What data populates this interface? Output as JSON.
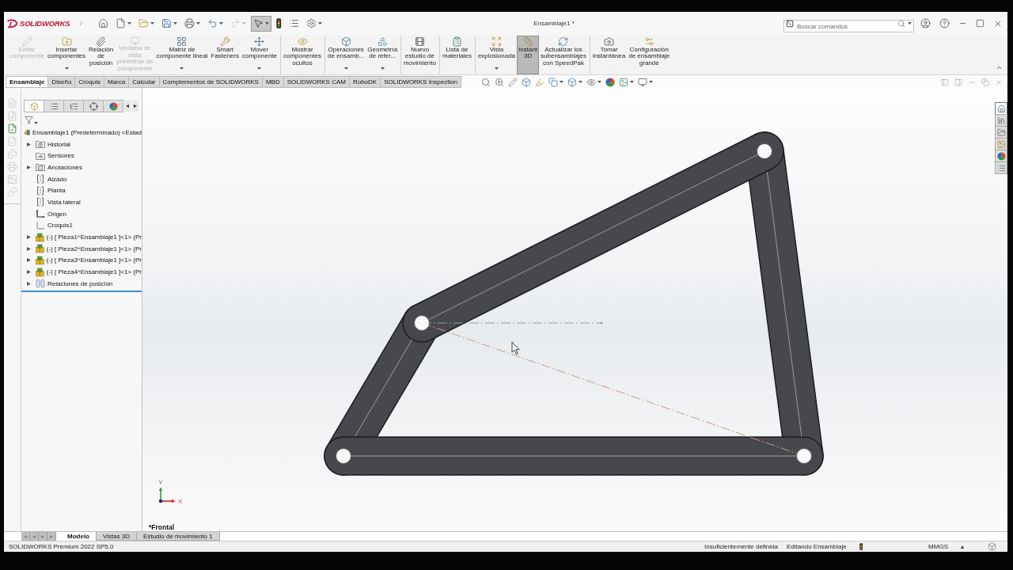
{
  "title_bar": {
    "logo": "SOLIDWORKS",
    "title": "Ensamblaje1 *",
    "search": {
      "placeholder": "Buscar comandos"
    }
  },
  "quick_access": [
    {
      "dropdown": false,
      "disabled": false,
      "selected": false
    },
    {
      "dropdown": true,
      "disabled": false,
      "selected": false
    },
    {
      "dropdown": true,
      "disabled": false,
      "selected": false
    },
    {
      "dropdown": true,
      "disabled": false,
      "selected": false
    },
    {
      "dropdown": true,
      "disabled": false,
      "selected": false
    },
    {
      "dropdown": true,
      "disabled": false,
      "selected": false
    },
    {
      "dropdown": true,
      "disabled": true,
      "selected": false
    },
    {
      "dropdown": true,
      "disabled": false,
      "selected": true
    },
    {
      "dropdown": false,
      "disabled": false,
      "selected": false
    },
    {
      "dropdown": false,
      "disabled": false,
      "selected": false
    },
    {
      "dropdown": true,
      "disabled": false,
      "selected": false
    }
  ],
  "ribbon": [
    {
      "label": "Editar\ncomponente",
      "dropdown": false,
      "disabled": true,
      "selected": false,
      "separator_before": false
    },
    {
      "label": "Insertar\ncomponentes",
      "dropdown": true,
      "disabled": false,
      "selected": false,
      "separator_before": false
    },
    {
      "label": "Relación\nde\nposición",
      "dropdown": false,
      "disabled": false,
      "selected": false,
      "separator_before": false
    },
    {
      "label": "Ventana de\nvista\npreliminar de\ncomponente",
      "dropdown": false,
      "disabled": true,
      "selected": false,
      "separator_before": false
    },
    {
      "label": "Matriz de\ncomponente lineal",
      "dropdown": true,
      "disabled": false,
      "selected": false,
      "separator_before": false
    },
    {
      "label": "Smart\nFasteners",
      "dropdown": false,
      "disabled": false,
      "selected": false,
      "separator_before": false
    },
    {
      "label": "Mover\ncomponente",
      "dropdown": true,
      "disabled": false,
      "selected": false,
      "separator_before": false
    },
    {
      "label": "Mostrar\ncomponentes\nocultos",
      "dropdown": false,
      "disabled": false,
      "selected": false,
      "separator_before": true
    },
    {
      "label": "Operaciones\nde ensamb...",
      "dropdown": true,
      "disabled": false,
      "selected": false,
      "separator_before": true
    },
    {
      "label": "Geometría\nde refer...",
      "dropdown": true,
      "disabled": false,
      "selected": false,
      "separator_before": false
    },
    {
      "label": "Nuevo\nestudio de\nmovimiento",
      "dropdown": false,
      "disabled": false,
      "selected": false,
      "separator_before": true
    },
    {
      "label": "Lista de\nmateriales",
      "dropdown": false,
      "disabled": false,
      "selected": false,
      "separator_before": true
    },
    {
      "label": "Vista\nexplosionada",
      "dropdown": true,
      "disabled": false,
      "selected": false,
      "separator_before": true
    },
    {
      "label": "Instant\n3D",
      "dropdown": false,
      "disabled": false,
      "selected": true,
      "separator_before": false
    },
    {
      "label": "Actualizar los\nsubensamblajes\ncon SpeedPak",
      "dropdown": false,
      "disabled": false,
      "selected": false,
      "separator_before": false
    },
    {
      "label": "Tomar\ninstantánea",
      "dropdown": false,
      "disabled": false,
      "selected": false,
      "separator_before": true
    },
    {
      "label": "Configuración\nde ensamblaje\ngrande",
      "dropdown": false,
      "disabled": false,
      "selected": false,
      "separator_before": false
    }
  ],
  "command_tabs": [
    {
      "label": "Ensamblaje",
      "selected": true
    },
    {
      "label": "Diseño",
      "selected": false
    },
    {
      "label": "Croquis",
      "selected": false
    },
    {
      "label": "Marca",
      "selected": false
    },
    {
      "label": "Calcular",
      "selected": false
    },
    {
      "label": "Complementos de SOLIDWORKS",
      "selected": false
    },
    {
      "label": "MBD",
      "selected": false
    },
    {
      "label": "SOLIDWORKS CAM",
      "selected": false
    },
    {
      "label": "RoboDK",
      "selected": false
    },
    {
      "label": "SOLIDWORKS Inspection",
      "selected": false
    }
  ],
  "heads_up_toolbar": [
    {
      "dropdown": false
    },
    {
      "dropdown": false
    },
    {
      "dropdown": false
    },
    {
      "dropdown": false
    },
    {
      "dropdown": false
    },
    {
      "dropdown": true
    },
    {
      "dropdown": true
    },
    {
      "dropdown": true
    },
    {
      "dropdown": false
    },
    {
      "dropdown": true
    },
    {
      "dropdown": true
    }
  ],
  "side_toolbar": [
    {
      "disabled": true
    },
    {
      "disabled": true
    },
    {
      "disabled": false
    },
    {
      "disabled": true
    },
    {
      "disabled": true
    },
    {
      "disabled": true
    },
    {
      "disabled": true
    },
    {
      "disabled": true
    }
  ],
  "panel_tabs": [
    {
      "selected": true
    },
    {
      "selected": false
    },
    {
      "selected": false
    },
    {
      "selected": false
    },
    {
      "selected": false
    }
  ],
  "feature_tree": {
    "label": "Ensamblaje1 (Predeterminado) <Estad",
    "kind": "assembly",
    "children": [
      {
        "label": "Historial",
        "kind": "history",
        "expanded": false
      },
      {
        "label": "Sensores",
        "kind": "sensors"
      },
      {
        "label": "Anotaciones",
        "kind": "annotations",
        "expanded": false
      },
      {
        "label": "Alzado",
        "kind": "plane"
      },
      {
        "label": "Planta",
        "kind": "plane"
      },
      {
        "label": "Vista lateral",
        "kind": "plane"
      },
      {
        "label": "Origen",
        "kind": "origin"
      },
      {
        "label": "Croquis1",
        "kind": "sketch"
      },
      {
        "label": "(-) [ Pieza1^Ensamblaje1 ]<1> (Pr",
        "kind": "part",
        "expanded": false
      },
      {
        "label": "(-) [ Pieza2^Ensamblaje1 ]<1> (Pr",
        "kind": "part",
        "expanded": false
      },
      {
        "label": "(-) [ Pieza3^Ensamblaje1 ]<1> (Pr",
        "kind": "part",
        "expanded": false
      },
      {
        "label": "(-) [ Pieza4^Ensamblaje1 ]<1> (Pr",
        "kind": "part",
        "expanded": false
      },
      {
        "label": "Relaciones de posición",
        "kind": "mates",
        "expanded": false
      }
    ]
  },
  "viewport": {
    "view_name": "*Frontal",
    "triad": {
      "y_label": "Y",
      "x_label": "X"
    }
  },
  "task_pane": [
    {
      "selected": true
    },
    {
      "selected": false
    },
    {
      "selected": false
    },
    {
      "selected": false
    },
    {
      "selected": false
    },
    {
      "selected": false
    }
  ],
  "bottom_tabs": [
    {
      "label": "Modelo",
      "selected": true
    },
    {
      "label": "Vistas 3D",
      "selected": false
    },
    {
      "label": "Estudio de movimiento 1",
      "selected": false
    }
  ],
  "status_bar": {
    "product": "SOLIDWORKS Premium 2022 SP5.0",
    "definition": "Insuficientemente definida",
    "mode": "Editando Ensamblaje",
    "units": "MMGS"
  }
}
